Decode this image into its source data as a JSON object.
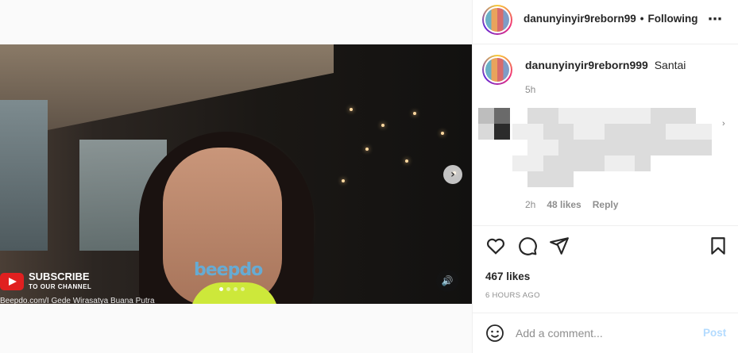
{
  "post": {
    "username": "danunyinyir9reborn99",
    "separator": "•",
    "follow_status": "Following",
    "more_icon": "⋯",
    "caption_username": "danunyinyir9reborn999",
    "caption_text": "Santai",
    "caption_time": "5h",
    "comment": {
      "time": "2h",
      "likes": "48 likes",
      "reply_label": "Reply"
    },
    "likes": "467 likes",
    "posted_ago": "6 HOURS AGO"
  },
  "media": {
    "watermark": "beepdo",
    "subscribe_title": "SUBSCRIBE",
    "subscribe_sub": "TO OUR CHANNEL",
    "credit_line": "Beepdo.com/I Gede Wirasatya Buana Putra",
    "carousel_total": 4,
    "carousel_active": 1,
    "next_icon": "›",
    "sound_icon": "🔊"
  },
  "comment_box": {
    "placeholder": "Add a comment...",
    "post_label": "Post"
  },
  "icons": [
    "heart-icon",
    "comment-icon",
    "share-icon",
    "bookmark-icon",
    "emoji-icon"
  ],
  "colors": {
    "post_button": "#b3dbff",
    "accent": "#0095f6",
    "shirt": "#cde83a"
  }
}
